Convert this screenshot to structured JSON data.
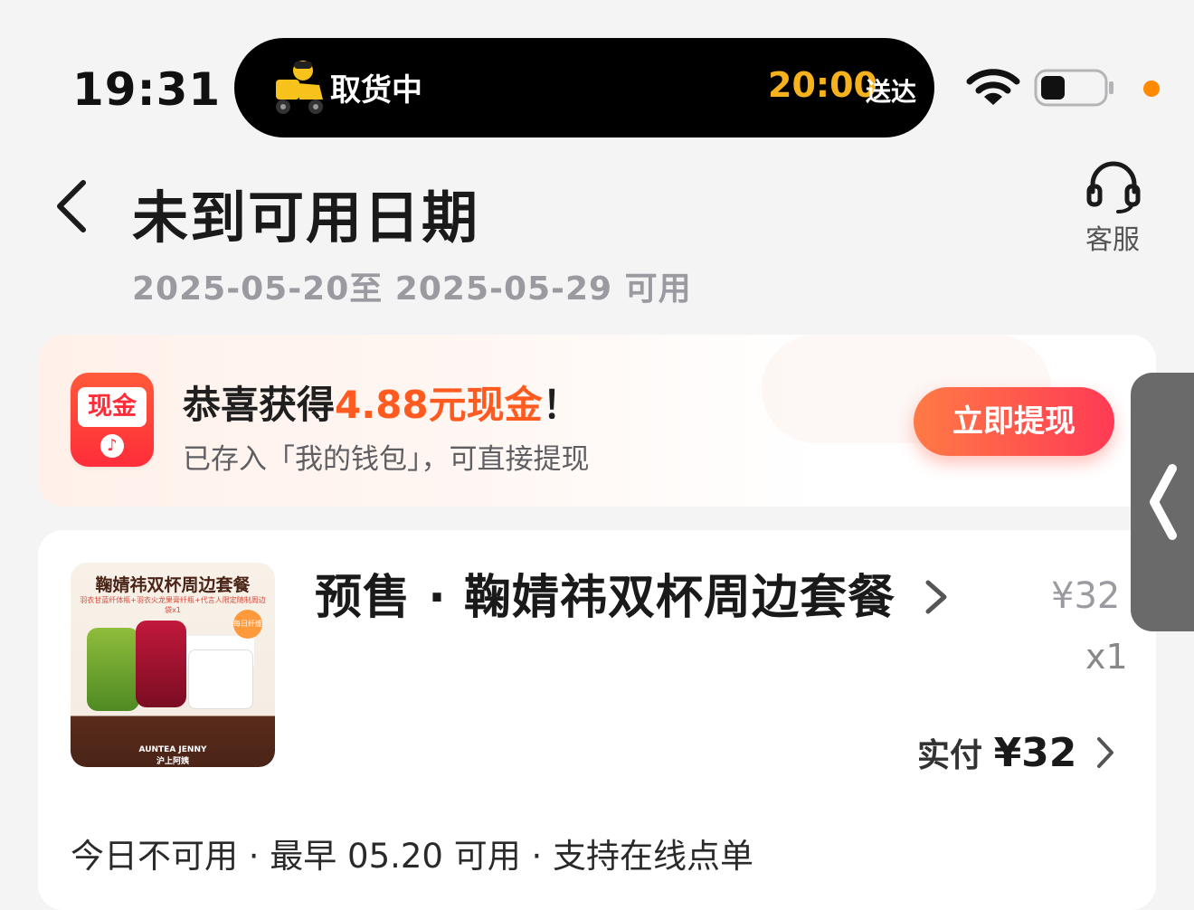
{
  "status_bar": {
    "time": "19:31",
    "island": {
      "status": "取货中",
      "eta_time": "20:00",
      "eta_label": "送达",
      "icon": "delivery-rider-icon"
    },
    "icons": [
      "wifi-icon",
      "battery-icon"
    ],
    "indicator_color": "#ff8a00"
  },
  "header": {
    "title": "未到可用日期",
    "date_range": "2025-05-20至 2025-05-29 可用",
    "support_label": "客服"
  },
  "cash_card": {
    "logo_text": "现金",
    "title_prefix": "恭喜获得",
    "title_amount": "4.88元现金",
    "title_suffix": "！",
    "subtitle": "已存入「我的钱包」，可直接提现",
    "button_label": "立即提现"
  },
  "order": {
    "thumbnail": {
      "title": "鞠婧祎双杯周边套餐",
      "subtitle": "羽衣甘蓝纤体瓶+羽衣火龙果膏纤瓶+代言人限定随制周边袋x1",
      "badge": "每日纤维",
      "brand_en": "AUNTEA JENNY",
      "brand_cn": "沪上阿姨"
    },
    "product_name": "预售 · 鞠婧祎双杯周边套餐",
    "price": "¥32",
    "quantity": "x1",
    "paid_label": "实付",
    "paid_amount": "¥32",
    "usage_note": "今日不可用 · 最早 05.20 可用 · 支持在线点单"
  },
  "accent_colors": {
    "orange": "#ff5a1f",
    "red": "#ff3a55",
    "eta_yellow": "#f5b21d"
  }
}
